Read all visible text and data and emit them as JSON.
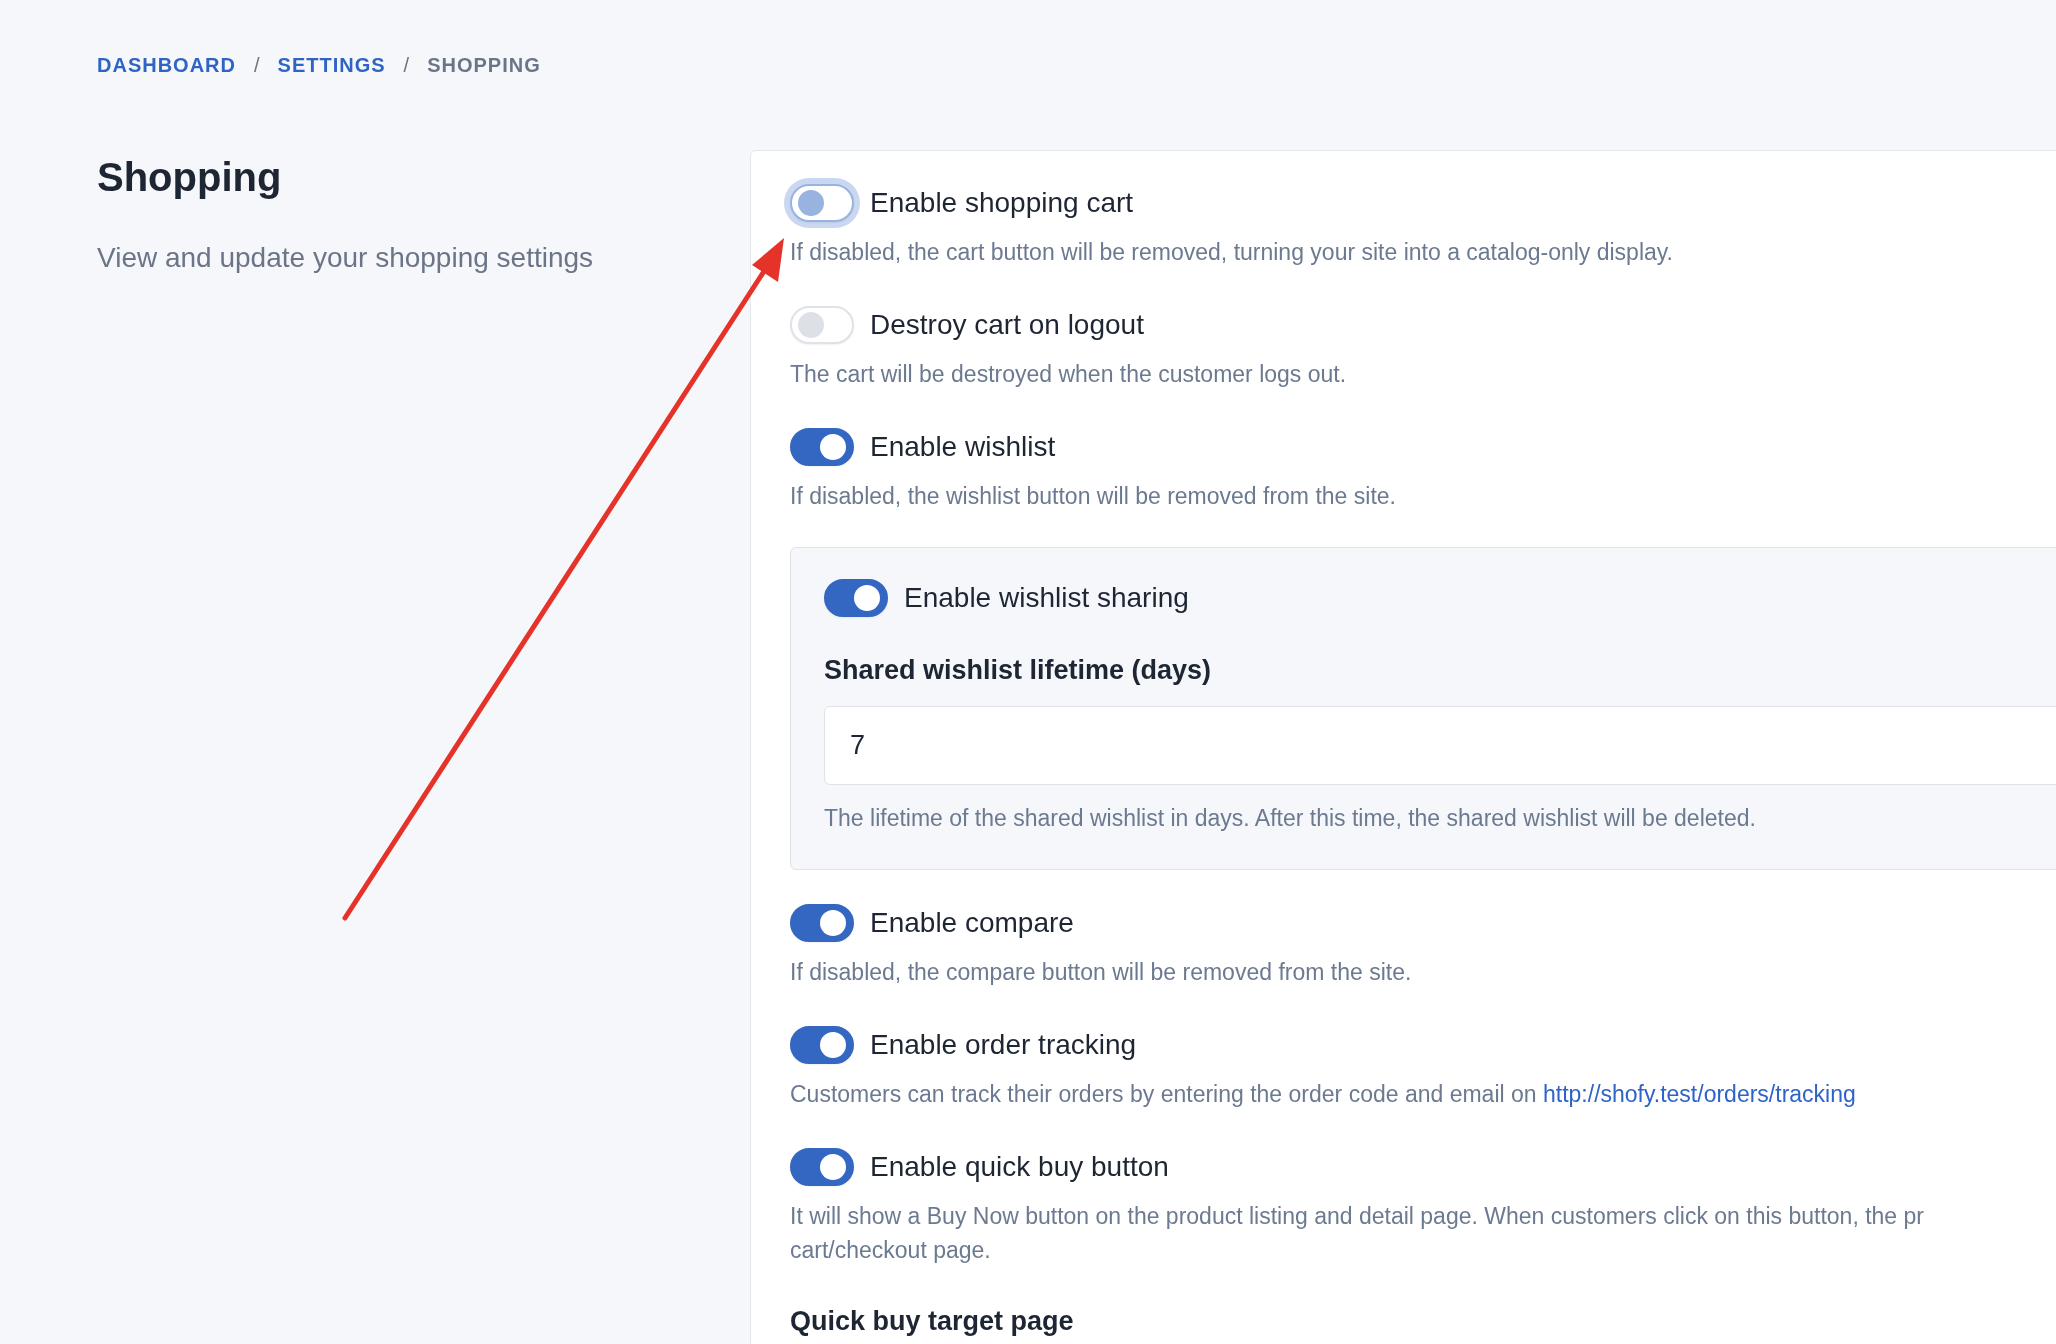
{
  "breadcrumb": [
    {
      "label": "DASHBOARD",
      "kind": "link",
      "separator": "/"
    },
    {
      "label": "SETTINGS",
      "kind": "link",
      "separator": "/"
    },
    {
      "label": "SHOPPING",
      "kind": "current"
    }
  ],
  "section": {
    "title": "Shopping",
    "subtitle": "View and update your shopping settings"
  },
  "settings": [
    {
      "kind": "toggle",
      "label": "Enable shopping cart",
      "on": false,
      "focused": true,
      "description": [
        "If disabled, the cart button will be removed, turning your site into a catalog-only display."
      ]
    },
    {
      "kind": "toggle",
      "label": "Destroy cart on logout",
      "on": false,
      "focused": false,
      "description": [
        "The cart will be destroyed when the customer logs out."
      ]
    },
    {
      "kind": "toggle",
      "label": "Enable wishlist",
      "on": true,
      "focused": false,
      "description": [
        "If disabled, the wishlist button will be removed from the site."
      ]
    },
    {
      "kind": "group",
      "toggle": {
        "label": "Enable wishlist sharing",
        "on": true,
        "focused": false
      },
      "field": {
        "label": "Shared wishlist lifetime (days)",
        "value": "7",
        "help": "The lifetime of the shared wishlist in days. After this time, the shared wishlist will be deleted."
      }
    },
    {
      "kind": "toggle",
      "label": "Enable compare",
      "on": true,
      "focused": false,
      "description": [
        "If disabled, the compare button will be removed from the site."
      ]
    },
    {
      "kind": "toggle",
      "label": "Enable order tracking",
      "on": true,
      "focused": false,
      "description": [
        "Customers can track their orders by entering the order code and email on "
      ],
      "link": "http://shofy.test/orders/tracking"
    },
    {
      "kind": "toggle",
      "label": "Enable quick buy button",
      "on": true,
      "focused": false,
      "description": [
        "It will show a Buy Now button on the product listing and detail page. When customers click on this button, the pr",
        "cart/checkout page."
      ]
    },
    {
      "kind": "heading",
      "label": "Quick buy target page"
    }
  ]
}
